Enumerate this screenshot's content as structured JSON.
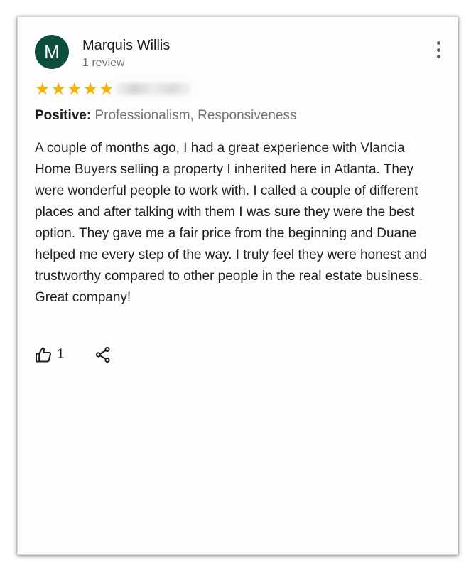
{
  "review": {
    "author": {
      "initial": "M",
      "name": "Marquis Willis",
      "review_count": "1 review",
      "avatar_color": "#0f4d3f"
    },
    "rating": 5,
    "stars": [
      "★",
      "★",
      "★",
      "★",
      "★"
    ],
    "star_color": "#f6b400",
    "positive_label": "Positive:",
    "positive_text": "Professionalism, Responsiveness",
    "text": "A couple of months ago, I had a great experience with Vlancia Home Buyers selling a property I inherited here in Atlanta. They were wonderful people to work with. I called a couple of different places and after talking with them I was sure they were the best option. They gave me a fair price from the beginning and Duane helped me every step of the way. I truly feel they were honest and trustworthy compared to other people in the real estate business. Great company!",
    "likes": "1",
    "icons": {
      "more": "more-vert-icon",
      "like": "thumb-up-icon",
      "share": "share-icon"
    }
  }
}
